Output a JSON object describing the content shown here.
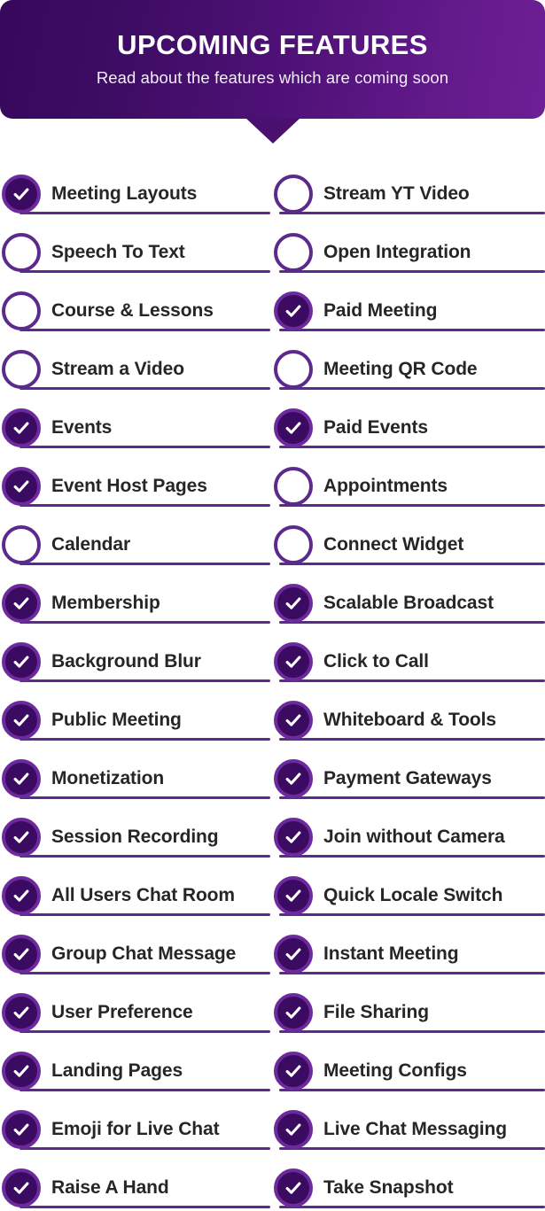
{
  "header": {
    "title": "UPCOMING FEATURES",
    "subtitle": "Read about the features which are coming soon",
    "gradient_start": "#36085c",
    "gradient_end": "#6d1f95",
    "pointer_color": "#4a1070"
  },
  "theme": {
    "checked_fill": "#3b0a61",
    "checked_ring": "#6d2a9e",
    "unchecked_ring": "#5b2a8c",
    "underline": "#5b2a8c",
    "label_color": "#262626",
    "background": "#ffffff"
  },
  "icons": {
    "checkmark": "check-icon",
    "empty": "empty-circle-icon"
  },
  "features": [
    {
      "label": "Meeting Layouts",
      "checked": true
    },
    {
      "label": "Stream YT Video",
      "checked": false
    },
    {
      "label": "Speech To Text",
      "checked": false
    },
    {
      "label": "Open Integration",
      "checked": false
    },
    {
      "label": "Course & Lessons",
      "checked": false
    },
    {
      "label": "Paid Meeting",
      "checked": true
    },
    {
      "label": "Stream a Video",
      "checked": false
    },
    {
      "label": "Meeting QR Code",
      "checked": false
    },
    {
      "label": "Events",
      "checked": true
    },
    {
      "label": "Paid Events",
      "checked": true
    },
    {
      "label": "Event Host Pages",
      "checked": true
    },
    {
      "label": "Appointments",
      "checked": false
    },
    {
      "label": "Calendar",
      "checked": false
    },
    {
      "label": "Connect Widget",
      "checked": false
    },
    {
      "label": "Membership",
      "checked": true
    },
    {
      "label": "Scalable Broadcast",
      "checked": true
    },
    {
      "label": "Background Blur",
      "checked": true
    },
    {
      "label": "Click to Call",
      "checked": true
    },
    {
      "label": "Public Meeting",
      "checked": true
    },
    {
      "label": "Whiteboard & Tools",
      "checked": true
    },
    {
      "label": "Monetization",
      "checked": true
    },
    {
      "label": "Payment Gateways",
      "checked": true
    },
    {
      "label": "Session Recording",
      "checked": true
    },
    {
      "label": "Join without Camera",
      "checked": true
    },
    {
      "label": "All Users Chat Room",
      "checked": true
    },
    {
      "label": "Quick Locale Switch",
      "checked": true
    },
    {
      "label": "Group Chat Message",
      "checked": true
    },
    {
      "label": "Instant Meeting",
      "checked": true
    },
    {
      "label": "User Preference",
      "checked": true
    },
    {
      "label": "File Sharing",
      "checked": true
    },
    {
      "label": "Landing Pages",
      "checked": true
    },
    {
      "label": "Meeting Configs",
      "checked": true
    },
    {
      "label": "Emoji for Live Chat",
      "checked": true
    },
    {
      "label": "Live Chat Messaging",
      "checked": true
    },
    {
      "label": "Raise A Hand",
      "checked": true
    },
    {
      "label": "Take Snapshot",
      "checked": true
    }
  ]
}
